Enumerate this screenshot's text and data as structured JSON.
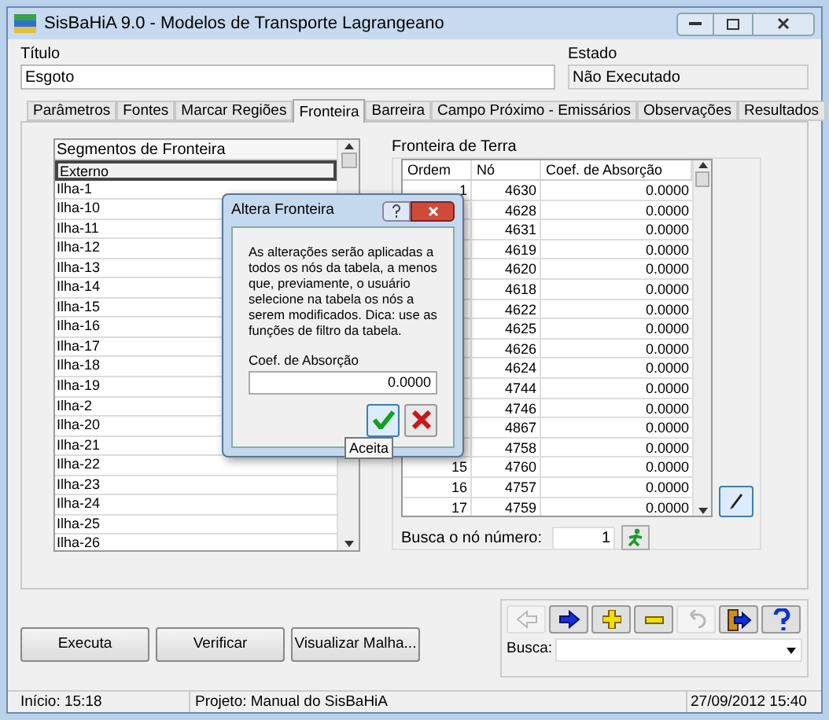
{
  "window": {
    "title": "SisBaHiA 9.0 - Modelos de Transporte Lagrangeano"
  },
  "fields": [
    {
      "label": "Título",
      "value": "Esgoto",
      "readonly": false
    },
    {
      "label": "Estado",
      "value": "Não Executado",
      "readonly": true
    }
  ],
  "tabs": [
    {
      "label": "Parâmetros",
      "selected": false
    },
    {
      "label": "Fontes",
      "selected": false
    },
    {
      "label": "Marcar Regiões",
      "selected": false
    },
    {
      "label": "Fronteira",
      "selected": true
    },
    {
      "label": "Barreira",
      "selected": false
    },
    {
      "label": "Campo Próximo - Emissários",
      "selected": false
    },
    {
      "label": "Observações",
      "selected": false
    },
    {
      "label": "Resultados",
      "selected": false
    }
  ],
  "segments": {
    "header": "Segmentos de Fronteira",
    "items": [
      {
        "label": "Externo",
        "selected": true
      },
      {
        "label": "Ilha-1",
        "selected": false
      },
      {
        "label": "Ilha-10",
        "selected": false
      },
      {
        "label": "Ilha-11",
        "selected": false
      },
      {
        "label": "Ilha-12",
        "selected": false
      },
      {
        "label": "Ilha-13",
        "selected": false
      },
      {
        "label": "Ilha-14",
        "selected": false
      },
      {
        "label": "Ilha-15",
        "selected": false
      },
      {
        "label": "Ilha-16",
        "selected": false
      },
      {
        "label": "Ilha-17",
        "selected": false
      },
      {
        "label": "Ilha-18",
        "selected": false
      },
      {
        "label": "Ilha-19",
        "selected": false
      },
      {
        "label": "Ilha-2",
        "selected": false
      },
      {
        "label": "Ilha-20",
        "selected": false
      },
      {
        "label": "Ilha-21",
        "selected": false
      },
      {
        "label": "Ilha-22",
        "selected": false
      },
      {
        "label": "Ilha-23",
        "selected": false
      },
      {
        "label": "Ilha-24",
        "selected": false
      },
      {
        "label": "Ilha-25",
        "selected": false
      },
      {
        "label": "Ilha-26",
        "selected": false
      }
    ]
  },
  "land_boundary": {
    "title": "Fronteira de Terra",
    "columns": [
      "Ordem",
      "Nó",
      "Coef. de Absorção"
    ],
    "rows": [
      {
        "ordem": "1",
        "no": "4630",
        "coef": "0.0000"
      },
      {
        "no": "4628",
        "coef": "0.0000"
      },
      {
        "no": "4631",
        "coef": "0.0000"
      },
      {
        "no": "4619",
        "coef": "0.0000"
      },
      {
        "no": "4620",
        "coef": "0.0000"
      },
      {
        "no": "4618",
        "coef": "0.0000"
      },
      {
        "no": "4622",
        "coef": "0.0000"
      },
      {
        "no": "4625",
        "coef": "0.0000"
      },
      {
        "no": "4626",
        "coef": "0.0000"
      },
      {
        "no": "4624",
        "coef": "0.0000"
      },
      {
        "no": "4744",
        "coef": "0.0000"
      },
      {
        "no": "4746",
        "coef": "0.0000"
      },
      {
        "no": "4867",
        "coef": "0.0000"
      },
      {
        "no": "4758",
        "coef": "0.0000"
      },
      {
        "ordem": "15",
        "no": "4760",
        "coef": "0.0000"
      },
      {
        "ordem": "16",
        "no": "4757",
        "coef": "0.0000"
      },
      {
        "ordem": "17",
        "no": "4759",
        "coef": "0.0000"
      }
    ],
    "search_label": "Busca o nó número:",
    "search_value": "1"
  },
  "buttons": [
    "Executa",
    "Verificar",
    "Visualizar Malha..."
  ],
  "toolbar": [
    {
      "kind": "back",
      "disabled": true
    },
    {
      "kind": "forward",
      "disabled": false
    },
    {
      "kind": "add",
      "disabled": false
    },
    {
      "kind": "remove",
      "disabled": false
    },
    {
      "kind": "undo",
      "disabled": true
    },
    {
      "kind": "exit",
      "disabled": false
    },
    {
      "kind": "help",
      "disabled": false
    }
  ],
  "busca": {
    "label": "Busca:"
  },
  "dialog": {
    "title": "Altera Fronteira",
    "message": "As alterações serão aplicadas a todos os nós da tabela, a menos que, previamente, o usuário selecione na tabela os nós a serem modificados. Dica: use as funções de filtro da tabela.",
    "field_label": "Coef. de Absorção",
    "field_value": "0.0000",
    "tooltip": "Aceita"
  },
  "status_bar": [
    "Início: 15:18",
    "Projeto: Manual do SisBaHiA",
    "27/09/2012 15:40"
  ]
}
